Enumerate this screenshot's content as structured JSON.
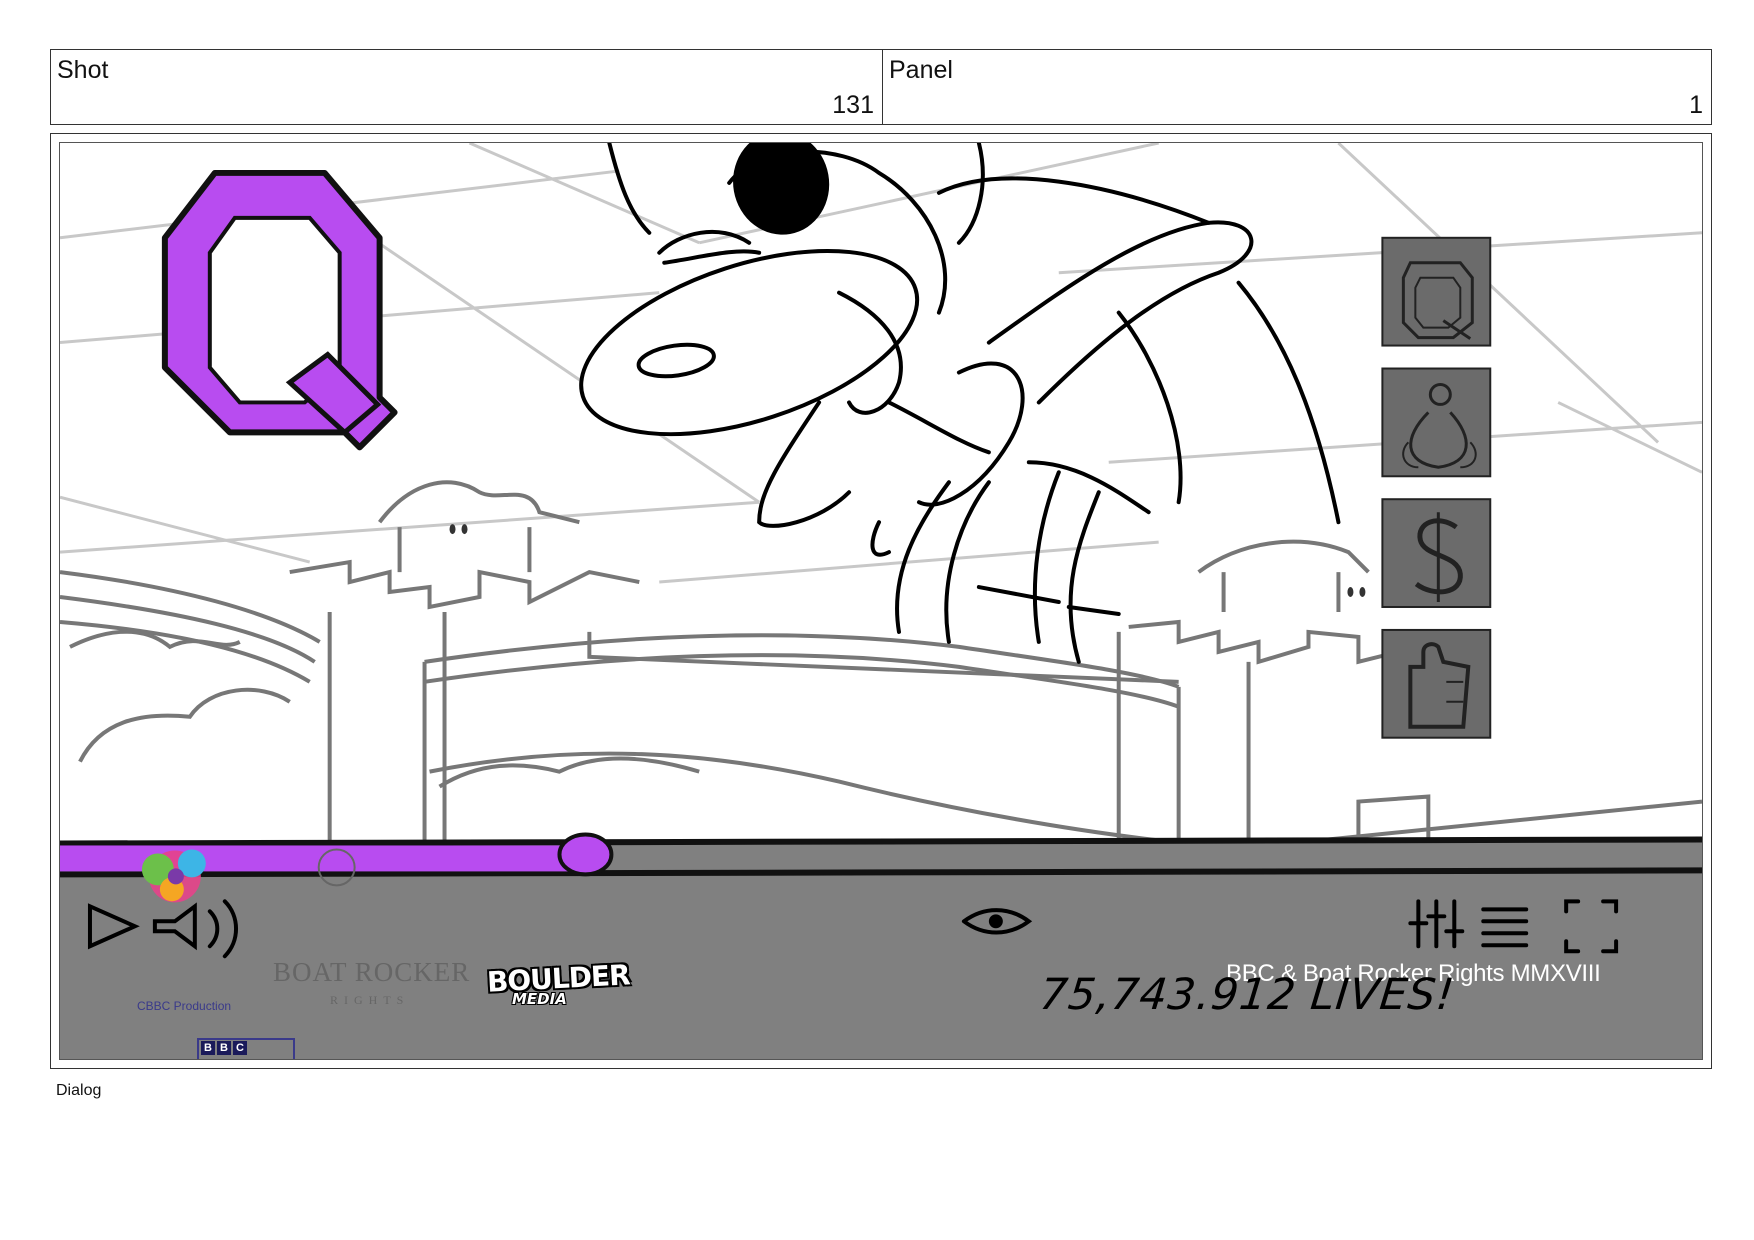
{
  "header": {
    "shot_label": "Shot",
    "shot_number": "131",
    "panel_label": "Panel",
    "panel_number": "1"
  },
  "panel_art": {
    "big_letter": "Q",
    "side_icons": [
      "q-letter-icon",
      "character-icon",
      "dollar-icon",
      "thumbs-up-icon"
    ],
    "bottom_bar": {
      "progress": 0.32,
      "copyright": "BBC & Boat Rocker Rights MMXVIII",
      "lives_counter": "75,743.912 LIVES!",
      "controls": [
        "play-icon",
        "volume-icon",
        "eye-icon",
        "equalizer-icon",
        "menu-icon",
        "fullscreen-icon"
      ]
    },
    "logos": {
      "bbc_letters": [
        "B",
        "B",
        "C"
      ],
      "cbbc_production": "CBBC Production",
      "boat_rocker": "BOAT ROCKER",
      "boat_rocker_rights": "RIGHTS",
      "boulder": "BOULDER",
      "boulder_media": "MEDIA"
    },
    "colors": {
      "accent_purple": "#b84cf0",
      "bar_gray": "#808080",
      "icon_box_gray": "#6b6b6b"
    }
  },
  "footer": {
    "dialog_label": "Dialog"
  }
}
